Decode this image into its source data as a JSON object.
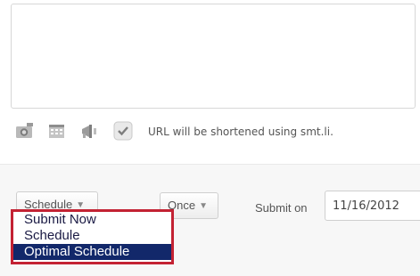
{
  "composer": {
    "message_value": "",
    "toolbar": {
      "icons": [
        "camera-icon",
        "calendar-icon",
        "megaphone-icon",
        "checkbox-icon"
      ],
      "checkbox_checked": true,
      "url_note": "URL will be shortened using smt.li."
    }
  },
  "schedule": {
    "schedule_button_label": "Schedule",
    "frequency_label": "Once",
    "submit_on_label": "Submit on",
    "date_value": "11/16/2012"
  },
  "dropdown": {
    "items": [
      {
        "label": "Submit Now",
        "selected": false
      },
      {
        "label": "Schedule",
        "selected": false
      },
      {
        "label": "Optimal Schedule",
        "selected": true
      }
    ],
    "highlight_color": "#c32233",
    "selected_color": "#12286a"
  }
}
